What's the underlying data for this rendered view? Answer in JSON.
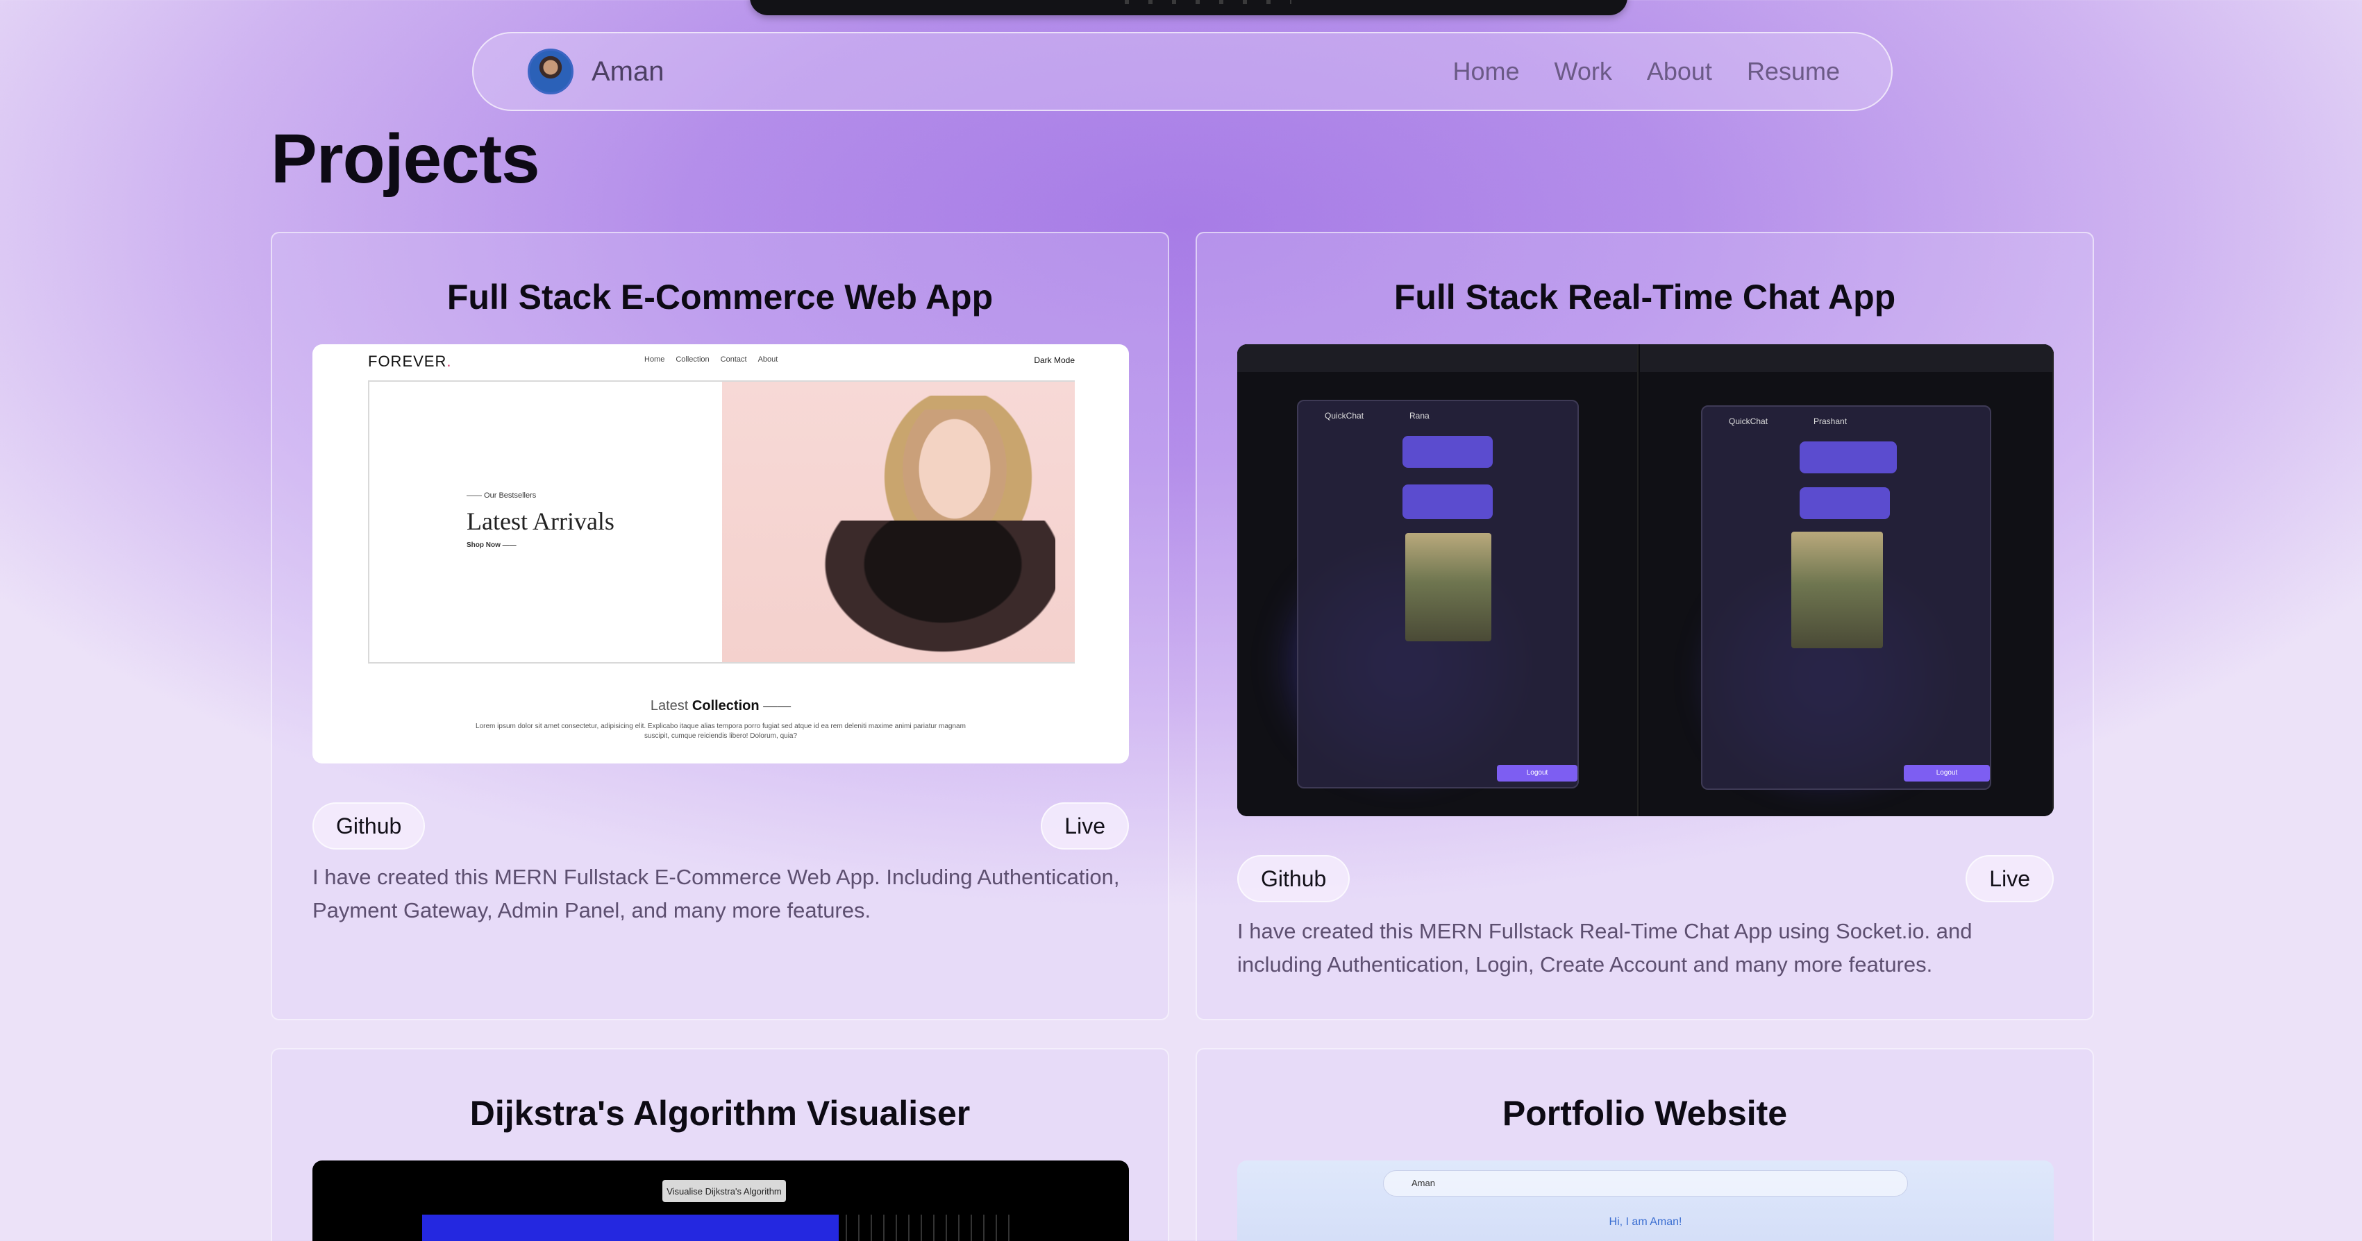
{
  "navbar": {
    "brand": "Aman",
    "links": [
      "Home",
      "Work",
      "About",
      "Resume"
    ]
  },
  "page_title": "Projects",
  "projects": [
    {
      "title": "Full Stack E-Commerce Web App",
      "github_label": "Github",
      "live_label": "Live",
      "description": "I have created this MERN Fullstack E-Commerce Web App. Including Authentication, Payment Gateway, Admin Panel, and many more features.",
      "screenshot": {
        "logo": "FOREVER",
        "logo_dot": ".",
        "menu": [
          "Home",
          "Collection",
          "Contact",
          "About"
        ],
        "dark_mode": "Dark Mode",
        "bestsellers": "—— Our Bestsellers",
        "hero_heading": "Latest Arrivals",
        "shop_now": "Shop Now ——",
        "collection_prefix": "Latest",
        "collection_word": "Collection",
        "collection_suffix": "——",
        "lorem": "Lorem ipsum dolor sit amet consectetur, adipisicing elit. Explicabo itaque alias tempora porro fugiat sed atque id ea rem deleniti maxime animi pariatur magnam suscipit, cumque reiciendis libero! Dolorum, quia?"
      }
    },
    {
      "title": "Full Stack Real-Time Chat App",
      "github_label": "Github",
      "live_label": "Live",
      "description": "I have created this MERN Fullstack Real-Time Chat App using Socket.io. and including Authentication, Login, Create Account and many more features.",
      "screenshot": {
        "app_name": "QuickChat",
        "left_contact": "Rana",
        "right_contact": "Prashant",
        "logout": "Logout"
      }
    },
    {
      "title": "Dijkstra's Algorithm Visualiser",
      "screenshot": {
        "button": "Visualise Dijkstra's Algorithm"
      }
    },
    {
      "title": "Portfolio Website",
      "screenshot": {
        "brand": "Aman",
        "greeting": "Hi, I am Aman!"
      }
    }
  ]
}
